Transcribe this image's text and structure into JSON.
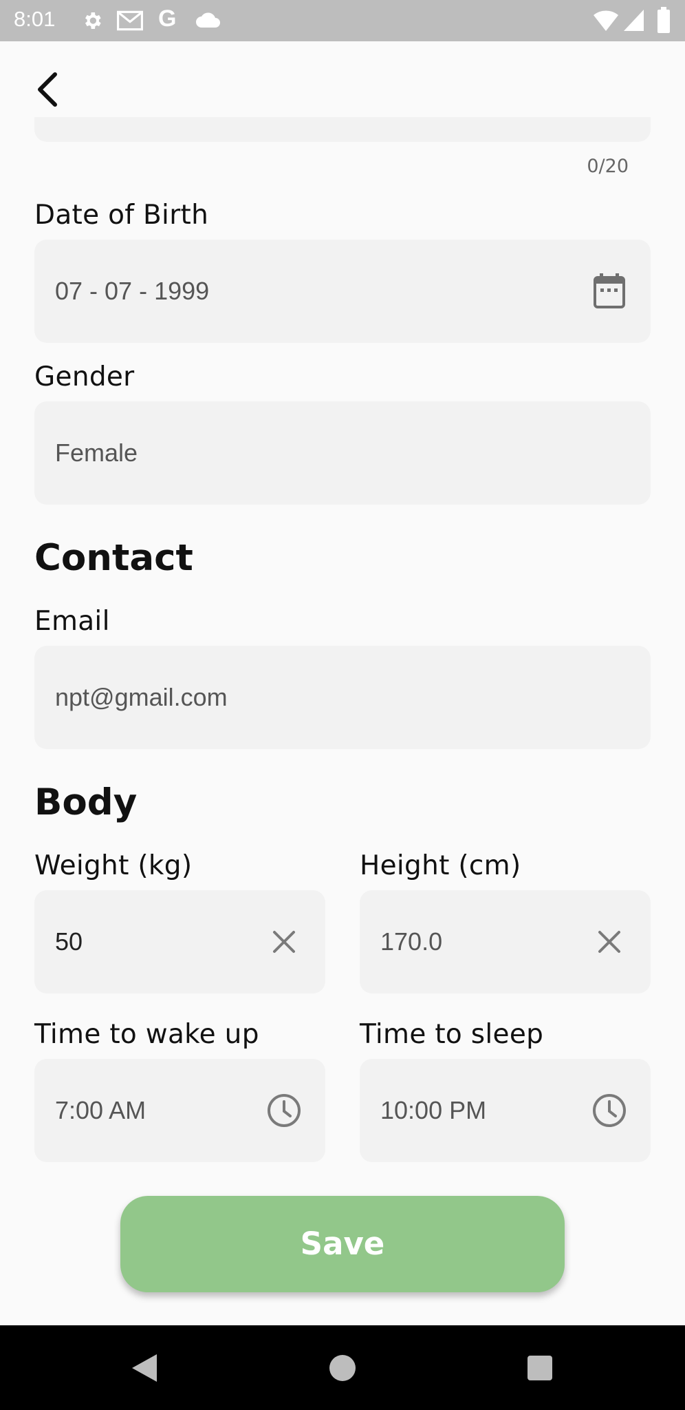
{
  "status_bar": {
    "time": "8:01",
    "icons": [
      "settings-icon",
      "gmail-icon",
      "google-icon",
      "cloud-icon",
      "wifi-icon",
      "signal-icon",
      "battery-icon"
    ]
  },
  "form": {
    "name_counter": "0/20",
    "dob": {
      "label": "Date of Birth",
      "value": "07 - 07 - 1999",
      "icon": "calendar-icon"
    },
    "gender": {
      "label": "Gender",
      "value": "Female"
    },
    "contact_section": "Contact",
    "email": {
      "label": "Email",
      "value": "npt@gmail.com"
    },
    "body_section": "Body",
    "weight": {
      "label": "Weight (kg)",
      "value": "50",
      "icon": "clear-icon"
    },
    "height": {
      "label": "Height (cm)",
      "value": "170.0",
      "icon": "clear-icon"
    },
    "wake": {
      "label": "Time to wake up",
      "value": "7:00 AM",
      "icon": "clock-icon"
    },
    "sleep": {
      "label": "Time to sleep",
      "value": "10:00 PM",
      "icon": "clock-icon"
    },
    "save_label": "Save"
  },
  "colors": {
    "save_button": "#92c78a",
    "field_bg": "#f2f2f2",
    "status_bar": "#bdbdbd"
  },
  "nav_bar": {
    "icons": [
      "back-triangle-icon",
      "home-circle-icon",
      "recents-square-icon"
    ]
  }
}
